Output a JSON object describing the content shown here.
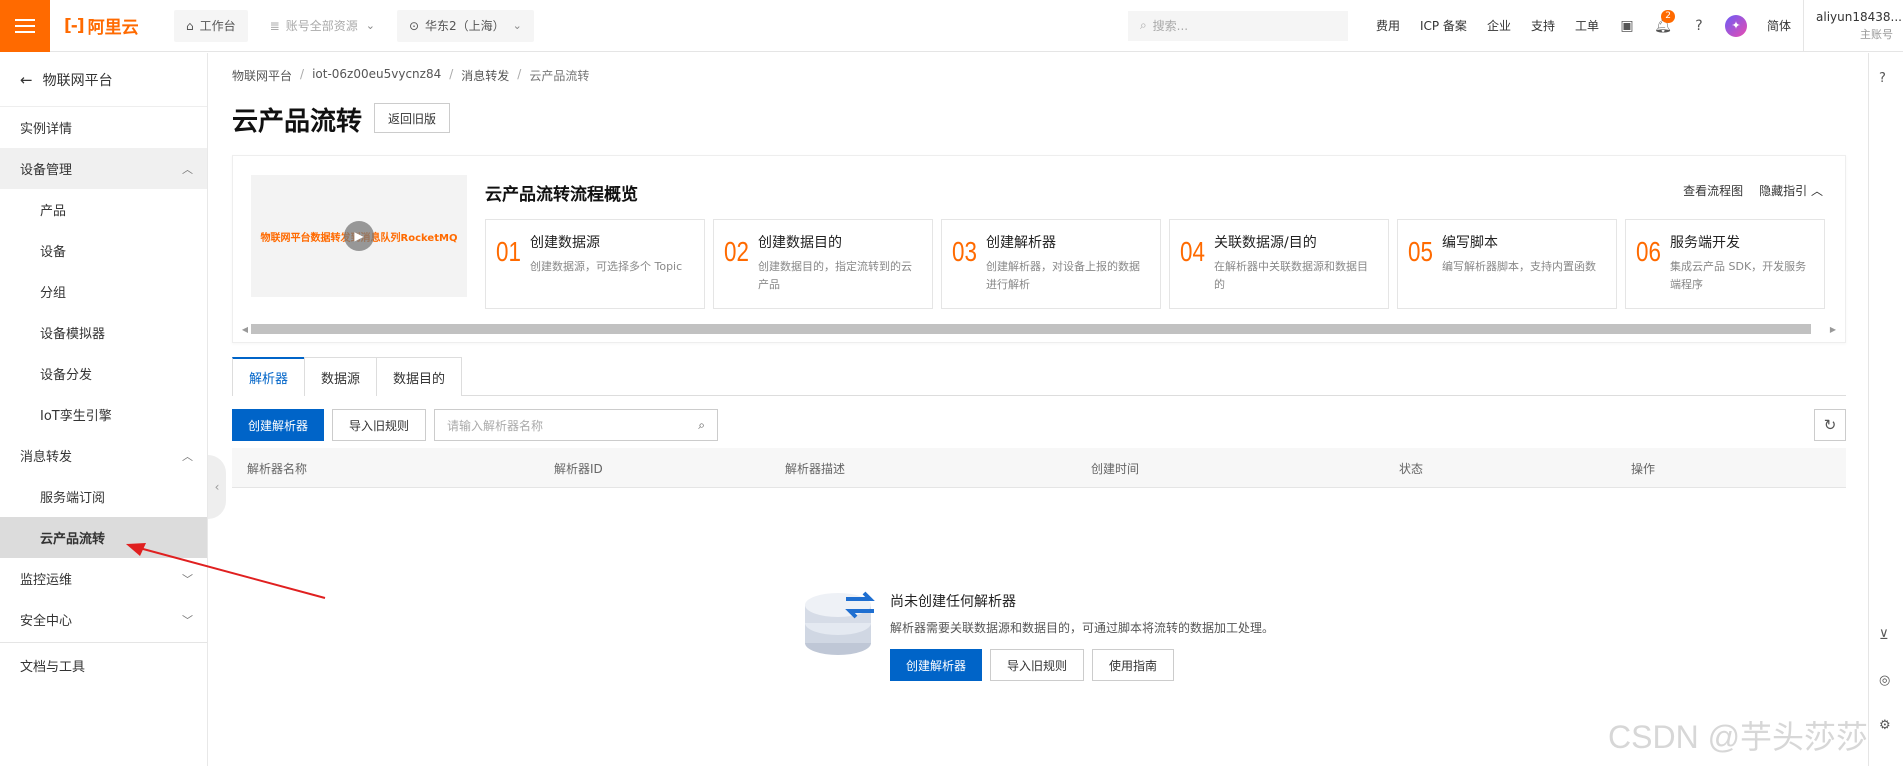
{
  "topbar": {
    "logo": "阿里云",
    "workbench": "工作台",
    "account_scope": "账号全部资源",
    "region": "华东2（上海）",
    "search_placeholder": "搜索...",
    "links": [
      "费用",
      "ICP 备案",
      "企业",
      "支持",
      "工单"
    ],
    "notification_count": "2",
    "lang": "简体",
    "user_name": "aliyun18438...",
    "user_role": "主账号"
  },
  "sidebar": {
    "back_label": "物联网平台",
    "items": {
      "instance_detail": "实例详情",
      "device_mgmt": "设备管理",
      "product": "产品",
      "device": "设备",
      "group": "分组",
      "device_simulator": "设备模拟器",
      "device_distribution": "设备分发",
      "iot_twin": "IoT孪生引擎",
      "message_forward": "消息转发",
      "server_subscribe": "服务端订阅",
      "cloud_forward": "云产品流转",
      "monitor_ops": "监控运维",
      "security_center": "安全中心",
      "docs_tools": "文档与工具"
    }
  },
  "breadcrumb": [
    "物联网平台",
    "iot-06z00eu5vycnz84",
    "消息转发",
    "云产品流转"
  ],
  "page": {
    "title": "云产品流转",
    "back_old": "返回旧版"
  },
  "overview": {
    "video_text": "物联网平台数据转发到消息队列RocketMQ",
    "title": "云产品流转流程概览",
    "view_flowchart": "查看流程图",
    "hide_guide": "隐藏指引",
    "steps": [
      {
        "num": "01",
        "title": "创建数据源",
        "desc": "创建数据源，可选择多个 Topic"
      },
      {
        "num": "02",
        "title": "创建数据目的",
        "desc": "创建数据目的，指定流转到的云产品"
      },
      {
        "num": "03",
        "title": "创建解析器",
        "desc": "创建解析器，对设备上报的数据进行解析"
      },
      {
        "num": "04",
        "title": "关联数据源/目的",
        "desc": "在解析器中关联数据源和数据目的"
      },
      {
        "num": "05",
        "title": "编写脚本",
        "desc": "编写解析器脚本，支持内置函数"
      },
      {
        "num": "06",
        "title": "服务端开发",
        "desc": "集成云产品 SDK，开发服务端程序"
      }
    ]
  },
  "tabs": [
    "解析器",
    "数据源",
    "数据目的"
  ],
  "toolbar": {
    "create": "创建解析器",
    "import": "导入旧规则",
    "search_placeholder": "请输入解析器名称"
  },
  "table": {
    "columns": [
      "解析器名称",
      "解析器ID",
      "解析器描述",
      "创建时间",
      "状态",
      "操作"
    ]
  },
  "empty": {
    "title": "尚未创建任何解析器",
    "desc": "解析器需要关联数据源和数据目的，可通过脚本将流转的数据加工处理。",
    "create": "创建解析器",
    "import": "导入旧规则",
    "guide": "使用指南"
  },
  "watermark": "CSDN @芋头莎莎",
  "colors": {
    "brand": "#ff6a00",
    "primary": "#0064c8"
  }
}
